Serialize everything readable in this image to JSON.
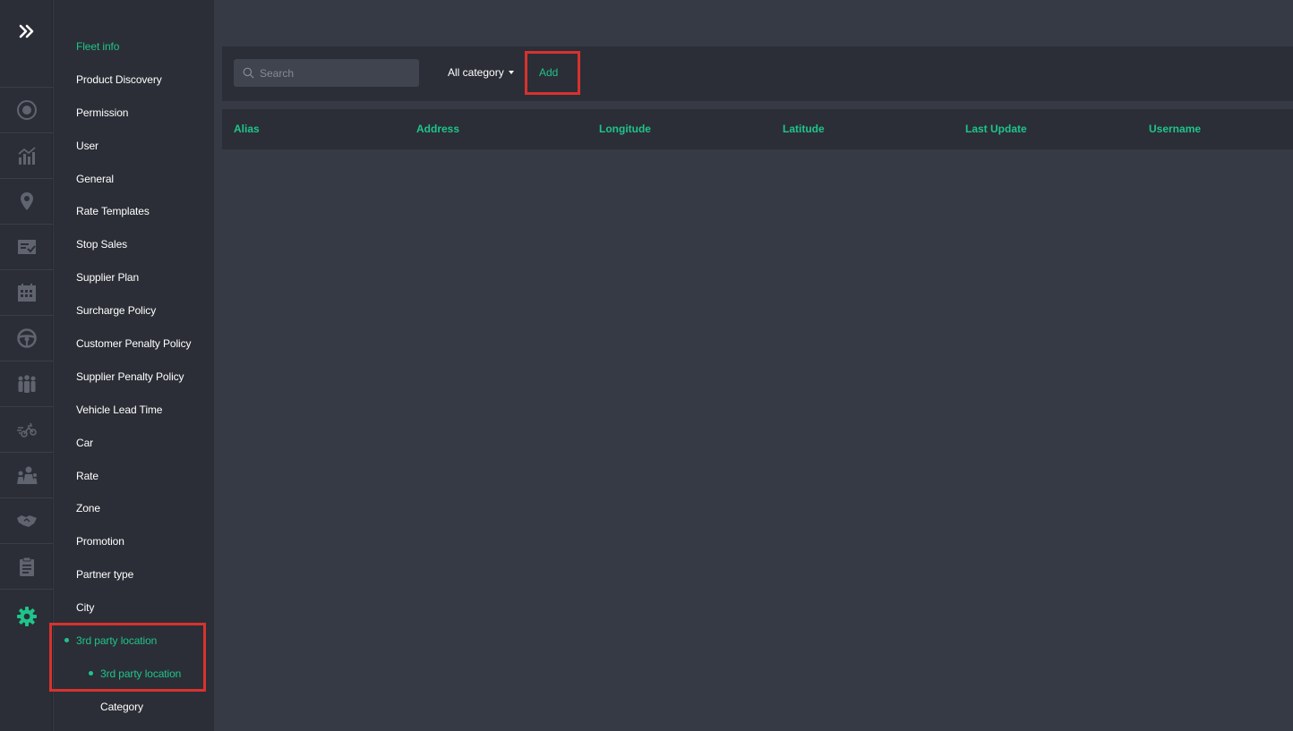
{
  "nav_rail": {
    "expand_icon": "double-chevron-right-icon",
    "icons": [
      "target-icon",
      "analytics-icon",
      "location-pin-icon",
      "checklist-icon",
      "calendar-icon",
      "steering-wheel-icon",
      "group-icon",
      "delivery-icon",
      "users-icon",
      "handshake-icon",
      "clipboard-icon",
      "settings-icon"
    ],
    "active_icon": "settings-icon"
  },
  "sidebar": {
    "items": [
      {
        "label": "Fleet info",
        "active": true
      },
      {
        "label": "Product Discovery"
      },
      {
        "label": "Permission"
      },
      {
        "label": "User"
      },
      {
        "label": "General"
      },
      {
        "label": "Rate Templates"
      },
      {
        "label": "Stop Sales"
      },
      {
        "label": "Supplier Plan"
      },
      {
        "label": "Surcharge Policy"
      },
      {
        "label": "Customer Penalty Policy"
      },
      {
        "label": "Supplier Penalty Policy"
      },
      {
        "label": "Vehicle Lead Time"
      },
      {
        "label": "Car"
      },
      {
        "label": "Rate"
      },
      {
        "label": "Zone"
      },
      {
        "label": "Promotion"
      },
      {
        "label": "Partner type"
      },
      {
        "label": "City"
      },
      {
        "label": "3rd party location",
        "active": true
      },
      {
        "label": "3rd party location",
        "active": true,
        "child": true
      },
      {
        "label": "Category",
        "child": true
      }
    ]
  },
  "toolbar": {
    "search_placeholder": "Search",
    "category_filter": "All category",
    "add_label": "Add"
  },
  "table": {
    "columns": [
      "Alias",
      "Address",
      "Longitude",
      "Latitude",
      "Last Update",
      "Username"
    ]
  },
  "colors": {
    "accent": "#1fc48a",
    "highlight": "#d8322e",
    "panel": "#2b2e36",
    "background": "#363a44"
  }
}
